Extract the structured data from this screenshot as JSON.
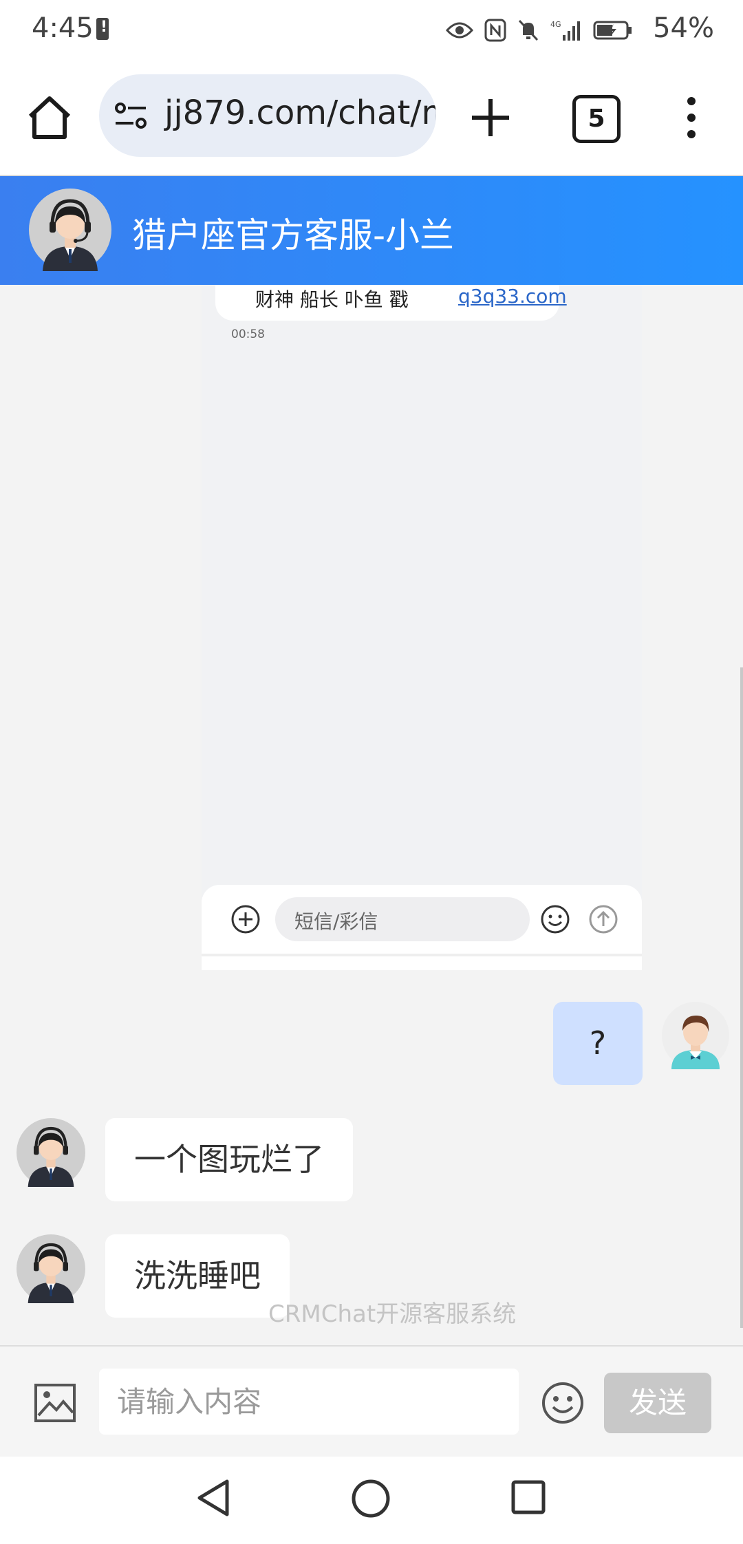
{
  "status_bar": {
    "time": "4:45",
    "network": "4G",
    "battery_percent": "54%",
    "icons": [
      "battery-alert-icon",
      "eye-icon",
      "nfc-icon",
      "mute-icon",
      "signal-icon",
      "battery-charging-icon"
    ]
  },
  "browser": {
    "url": "jj879.com/chat/m",
    "tab_count": "5",
    "icons": [
      "home-icon",
      "site-settings-icon",
      "plus-icon",
      "menu-dots-icon"
    ]
  },
  "chat_header": {
    "title": "猎户座官方客服-小兰"
  },
  "shared_image": {
    "message_names": "财神  船长  卟鱼  戳",
    "link": "q3q33.com",
    "time": "00:58",
    "compose_placeholder": "短信/彩信"
  },
  "messages": [
    {
      "sender": "user",
      "text": "?"
    },
    {
      "sender": "agent",
      "text": "一个图玩烂了"
    },
    {
      "sender": "agent",
      "text": "洗洗睡吧"
    }
  ],
  "footer_brand": "CRMChat开源客服系统",
  "input_bar": {
    "placeholder": "请输入内容",
    "send_label": "发送"
  },
  "colors": {
    "header_gradient_start": "#3a7ff0",
    "header_gradient_end": "#2592ff",
    "user_bubble": "#cfe0ff",
    "send_button_disabled": "#c8c8c8"
  }
}
